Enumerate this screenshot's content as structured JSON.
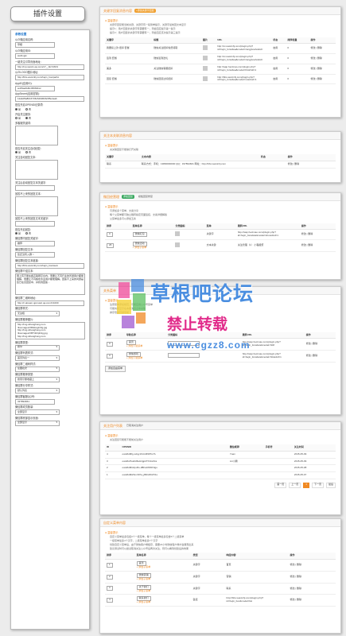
{
  "page_title": "插件设置",
  "sidebar": {
    "section_title": "参数设置",
    "app_name_label": "公众微应用名称:",
    "app_name_value": "草根",
    "app_id_label": "公众微应用ID:",
    "app_id_value": "weihugin",
    "api_label": "一键关注引导页面地址:",
    "api_value": "http://mp.weixin.qq.com/s?__biz=MzI4",
    "logo_label": "公众LOGO图片地址:",
    "logo_value": "http://bbs.weixinhj.com/hejin_bos/pathc",
    "appid_label": "AppID(应用ID):",
    "appid_value": "wx83ad0d6c45963bcc",
    "secret_label": "AppSecret(应用密钥):",
    "secret_value": "12abd5a8b16736c64930b6c85e4eab",
    "openid_label": "是否开启OPENID记录项:",
    "openid_radio": [
      "是",
      "否"
    ],
    "subscribe_label": "开启关注服务:",
    "subscribe_radio": [
      "是",
      "否"
    ],
    "multi_label": "多客服关键词:",
    "auto_reply_label": "是否开启关注自动回复:",
    "auto_radio": [
      "是",
      "否"
    ],
    "auto_text_label": "关注自动回复文本:",
    "kw_reply_label": "关注后自动回复文本关键字:",
    "default_reply_label": "回答不上来的回复文本:",
    "cannot_kw_label": "回答不上来的回复文本关键字:",
    "enable_label": "是否开启回复:",
    "enable_radio": [
      "是",
      "否"
    ],
    "group_kw_label": "微信群内回复关键字:",
    "group_kw_value": "推荐",
    "group_text_label": "微信群回复文本:",
    "group_text_value": "您还没有入群 >",
    "group_url_label": "微信群回复文本链接:",
    "group_url_value": "http://bbs.weixinhj.com/hejin_bos/weix",
    "intro_label": "微信群介绍文本:",
    "intro_value": "网上有不能在各互联网平台内，而要让不同行业的普通用户都能理解，而要让不同各色专业用户都能理解。回答不上来的问题是您已在该回复中，并找到回答...",
    "qr_label": "微信群二维码地址:",
    "qr_value": "http://c.atream.qpmusic.qq.com/C1000",
    "style_label": "微信群样式:",
    "style_value": "无边框",
    "images_label": "微信群推荐图片:",
    "images_value": [
      "http://img.sthanghong.com",
      "/livemages/3RHkogkz3g.jpg",
      "http://img.sthanghong.com",
      "/livemages/VBT4tOpK2g.jpg",
      "http://img.sthanghong.com"
    ],
    "group_type_label": "微信群类型:",
    "group_type_value": "搜尔",
    "list_style_label": "微信群列表样式:",
    "list_style_value": "首页列表一",
    "qr_style_label": "微信群二维码样式:",
    "qr_style_value": "左图右文",
    "recommend_label": "微信群推荐类型:",
    "recommend_value": "搜索引擎收藏上",
    "share_label": "微信群分享样式:",
    "share_value": "默认列表",
    "qq_label": "微信群客服QQ号:",
    "qq_value": "337894661",
    "member_label": "微信群成员数量:",
    "member_value": "全部显示",
    "bottom_label": "微信群底部显示页面:",
    "bottom_value": "全部显示"
  },
  "panel1": {
    "title": "关键字回复消息内容",
    "badge": "+添加关键字回复",
    "tip": "温馨提示",
    "notes": [
      "关键字回复能当前关键，关键字有一段简单提示，关键字最前回文本显示",
      "提示1：用户回复的关键字有需要有一，则会回应提示第一提示",
      "提示2：用户回复的关键字有需要有一，则会回应该次提示第三提示"
    ],
    "columns": [
      "关键字",
      "标题",
      "图片",
      "URL",
      "状态",
      "排序权重",
      "操作"
    ],
    "rows": [
      {
        "kw": "我要投上款 抵扣 套餐",
        "title": "微信关注抵扣免费领取",
        "url": "http://xx.weixinhj.com/plugin.php?id=hejin_forwdwa&model=zangjzewho&id=",
        "state": "启用",
        "order": "0",
        "ops": "修改 | 删除"
      },
      {
        "kw": "签到 套餐",
        "title": "微信签到送礼",
        "url": "http://xx.weixinhj.com/plugin.php?id=hejin_forwdwa&model=zangjzewho&id=",
        "state": "启用",
        "order": "0",
        "ops": "修改 | 删除"
      },
      {
        "kw": "美多",
        "title": "关注微信客服抵扣",
        "url": "http://wap.hecimao.com/plugin.php?id=hejin_forwdwa&model=hbdcfull=1",
        "state": "启用",
        "order": "0",
        "ops": "修改 | 删除"
      },
      {
        "kw": "回复 套餐",
        "title": "微信回复达标抵扣",
        "url": "http://bbs.weixinhj.com/plugin.php?id=hejin_forwdwa&model=votebod=1",
        "state": "启用",
        "order": "0",
        "ops": "修改 | 删除"
      }
    ]
  },
  "panel2": {
    "title": "关注本关联消息内容",
    "tip": "温馨提示",
    "note": "关关联回复不能够打开关联",
    "columns": [
      "关键字",
      "文本内容",
      "状态",
      "操作"
    ],
    "row": {
      "kw": "联系",
      "text": "联系方式：手机：13800000000 QQ：337894661 网址：http://bbs.weixinhj.com",
      "ops": "修改 | 删除"
    }
  },
  "panel3": {
    "title": "微回经营理",
    "badge": "添加回复",
    "badge2": "模板回复修复",
    "tip": "温馨提示",
    "notes": [
      "可添加多个菜单，文案分享",
      "每个父菜单都可独立跳转指定页面链接，文案详细解版",
      "父菜单最多可以添加五条"
    ],
    "columns": [
      "排序",
      "菜单名称",
      "分类图标",
      "菜单",
      "跳转URL",
      "操作"
    ],
    "rows": [
      {
        "order": "0",
        "name": "微信红包",
        "type": "关键字",
        "url": "http://wap.hecimao.com/plugin.php?id=hejin_forwdwa&model=showdivd=1",
        "ops": "修改 | 删除"
      },
      {
        "order": "26",
        "name": "微信活动",
        "sub": "+ 添加子菜单",
        "type": "文本关键",
        "url": "关注管理（1）  小程组聚",
        "ops": "修改 | 删除"
      }
    ]
  },
  "panel4": {
    "title": "关系菜单",
    "tip": "温馨提示",
    "notes": [
      "注意菜单添加规范，可能应用公众号菜单",
      "可能将能显示在本期消息之中关联",
      "排序值越高越靠前"
    ],
    "columns": [
      "排序",
      "导航名称",
      "分类图标",
      "跳转URL",
      "操作"
    ],
    "rows": [
      {
        "order": "0",
        "name": "首页",
        "sub": "+ 添加下级菜单",
        "url": "http://wap.hecimao.com/plugin.php?id=hejin_forwdwa&model=hb8",
        "ops": "修改 | 删除"
      },
      {
        "order": "0",
        "name": "微信游戏",
        "sub": "+ 添加下级菜单",
        "url": "http://wap.hecimao.com/plugin.php?id=hejin_forwdwa&model=hbdefull=1",
        "ops": "修改 | 删除"
      }
    ],
    "add_button": "添加自由菜单"
  },
  "panel5": {
    "title": "关注用户列表",
    "badge": "已取消关注用户",
    "tip": "温馨提示",
    "note": "关注回复可能能不能前关注用户",
    "columns": [
      "ID",
      "OPENID",
      "微信昵称",
      "手机号",
      "关注时间"
    ],
    "rows": [
      {
        "id": "4",
        "openid": "owwfkd9fg-Ldqy1FLG0I99Tu7A",
        "nick": "Yuan",
        "phone": "",
        "time": "2015-05-09"
      },
      {
        "id": "3",
        "openid": "owwfkd7ek2d6oH4gpkTXJzeKks",
        "nick": "Lin小鹏",
        "phone": "",
        "time": "2015-05-09"
      },
      {
        "id": "2",
        "openid": "owwfkd9G2pu5s-dBFa4X6ROtgu",
        "nick": "",
        "phone": "",
        "time": "2015-05-08"
      },
      {
        "id": "1",
        "openid": "owwfkd9tZGmN7ia_jBRsDKZX1s",
        "nick": "",
        "phone": "",
        "time": "2015-05-07"
      }
    ],
    "pager": [
      "首一页",
      "上一页",
      "1",
      "下一页",
      "最后"
    ]
  },
  "panel6": {
    "title": "自定义菜单内容",
    "tip": "温馨提示",
    "notes": [
      "自定义菜单最多包括3个一级菜单，每个一级菜单最多包含5个二级菜单",
      "一级菜单最多4个汉字，二级菜单最多7个汉字",
      "创建自定义菜单后，由于微信客户端缓存，需要24小时微信客户端才会展现出来",
      "建议测试时可以尝试取消关注公众号后再次关注，则可以看到创建后的效果"
    ],
    "columns": [
      "排序",
      "菜单名称",
      "类型",
      "响应内容",
      "操作"
    ],
    "rows": [
      {
        "order": "1",
        "name": "首页",
        "sub": "+ 添加子菜单",
        "type": "关键字",
        "resp": "首页",
        "ops": "修改 | 删除"
      },
      {
        "order": "2",
        "name": "微信营销",
        "sub": "+ 添加子菜单",
        "type": "关键字",
        "resp": "营销",
        "ops": "修改 | 删除"
      },
      {
        "order": "3",
        "name": "关于我们",
        "sub": "+ 添加子菜单",
        "type": "关键字",
        "resp": "联系",
        "ops": "修改 | 删除"
      },
      {
        "order": "4",
        "name": "联系我们",
        "sub": "+ 添加子菜单",
        "type": "链接",
        "resp": "http://bbs.weixinhj.com/plugin.php?id=hejin_box&model=list",
        "ops": "修改 | 删除"
      }
    ]
  },
  "watermark": {
    "line1": "草根吧论坛",
    "line2": "禁止转载",
    "line3": "www.cgzz8.com"
  }
}
